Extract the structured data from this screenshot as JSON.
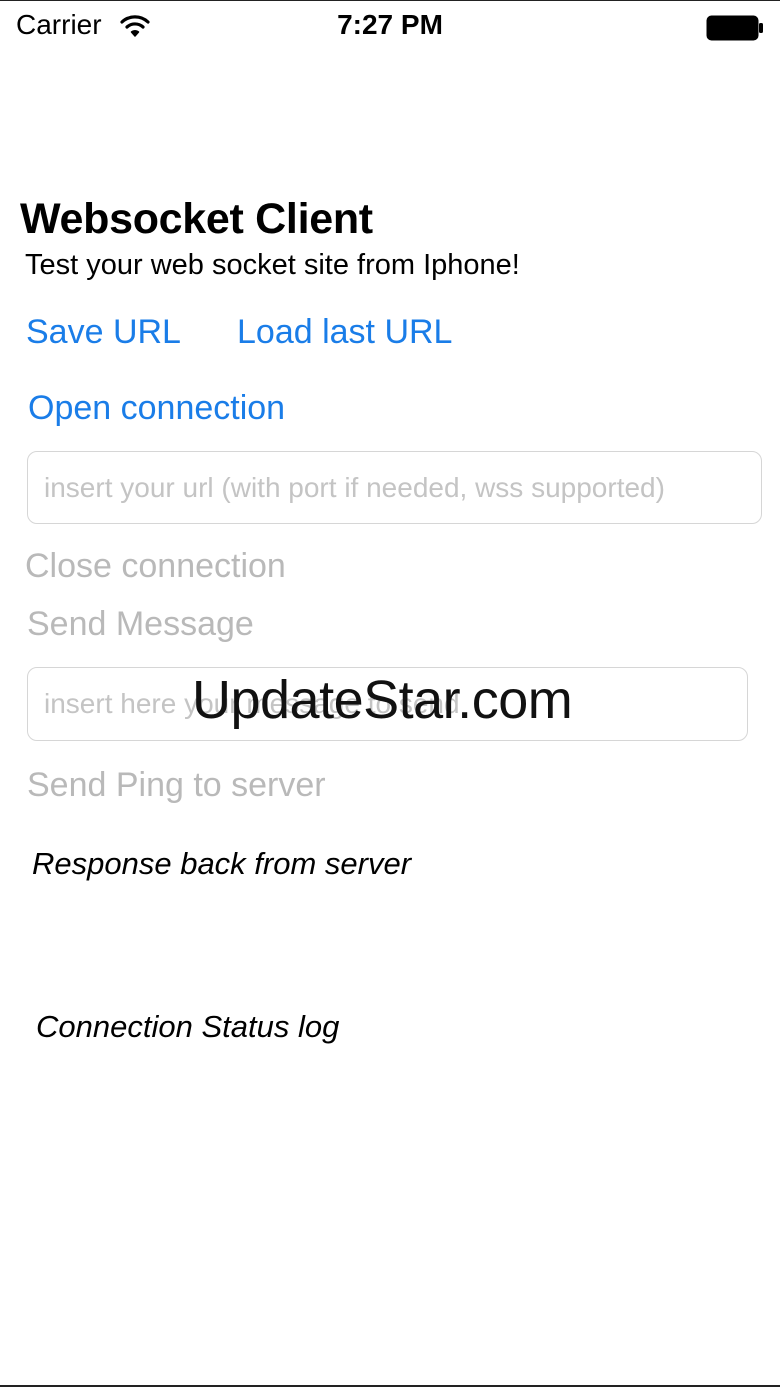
{
  "status_bar": {
    "carrier": "Carrier",
    "time": "7:27 PM",
    "icons": [
      "wifi-icon",
      "battery-icon"
    ]
  },
  "app": {
    "title": "Websocket Client",
    "subtitle": "Test your web socket site from Iphone!"
  },
  "actions": {
    "save_url": "Save URL",
    "load_last_url": "Load last URL",
    "open_connection": "Open connection",
    "close_connection": "Close connection",
    "send_message": "Send Message",
    "send_ping": "Send Ping to server"
  },
  "inputs": {
    "url": {
      "value": "",
      "placeholder": "insert your url (with port if needed, wss supported)"
    },
    "message": {
      "value": "",
      "placeholder": "insert here your message to send"
    }
  },
  "labels": {
    "response": "Response back from server",
    "status_log": "Connection Status log"
  },
  "watermark": "UpdateStar.com",
  "colors": {
    "accent": "#1a7de8",
    "disabled": "#b9b9b9",
    "placeholder": "#c4c4c4"
  }
}
